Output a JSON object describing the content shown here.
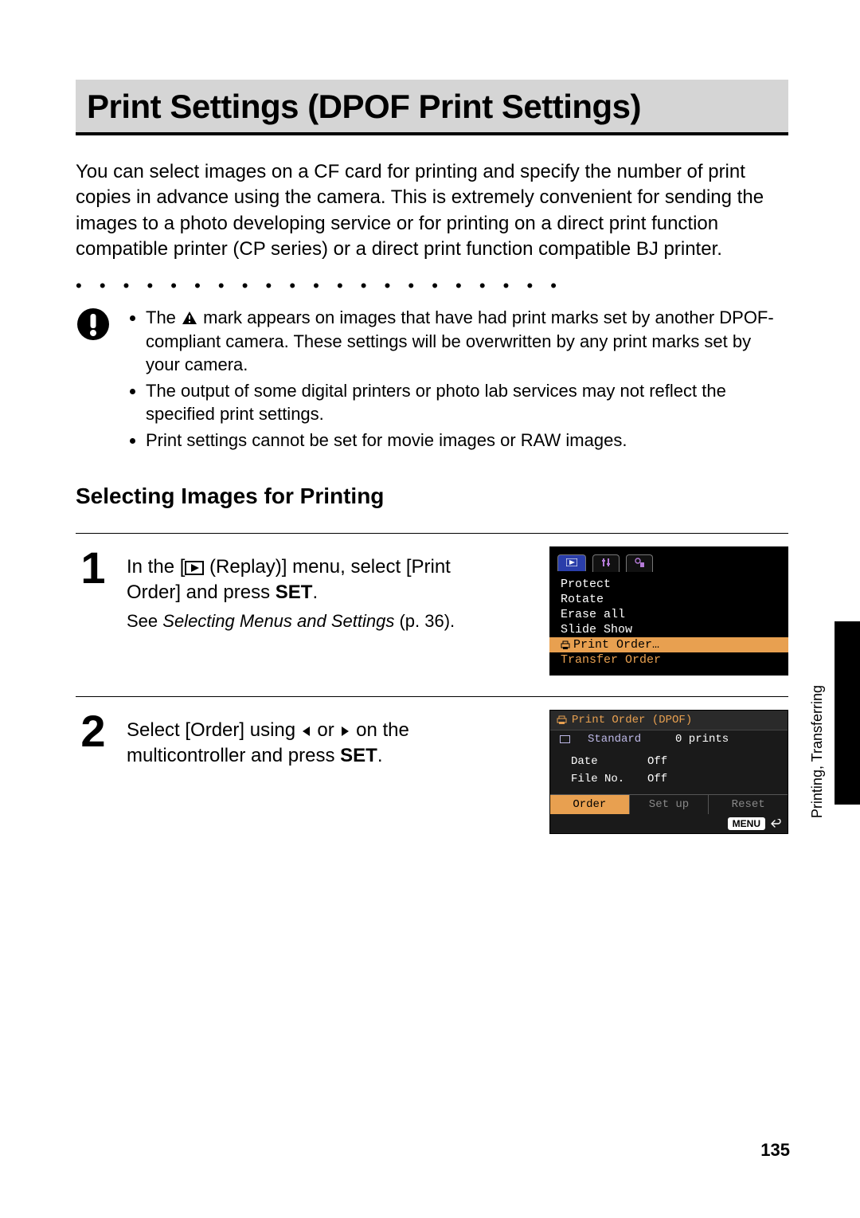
{
  "page_number": "135",
  "side_tab": "Printing, Transferring",
  "title": "Print Settings (DPOF Print Settings)",
  "intro": "You can select images on a CF card for printing and specify the number of print copies in advance using the camera. This is extremely convenient for sending the images to a photo developing service or for printing on a direct print function compatible printer (CP series) or a direct print function compatible BJ printer.",
  "warn": {
    "b1a": "The ",
    "b1b": " mark appears on images that have had print marks set by another DPOF-compliant camera. These settings will be overwritten by any print marks set by your camera.",
    "b2": "The output of some digital printers or photo lab services may not reflect the specified print settings.",
    "b3": "Print settings cannot be set for movie images or RAW images."
  },
  "subhead": "Selecting Images for Printing",
  "step1": {
    "num": "1",
    "line_a": "In the [",
    "line_b": " (Replay)] menu, select [Print Order] and press ",
    "line_c": "SET",
    "line_d": ".",
    "ref_a": "See ",
    "ref_b": "Selecting Menus and Settings",
    "ref_c": " (p. 36).",
    "lcd": {
      "items": [
        "Protect",
        "Rotate",
        "Erase all",
        "Slide Show",
        "Print Order…",
        "Transfer Order"
      ],
      "selected_index": 4
    }
  },
  "step2": {
    "num": "2",
    "line_a": "Select [Order] using ",
    "line_b": " or ",
    "line_c": " on the multicontroller and press ",
    "line_d": "SET",
    "line_e": ".",
    "lcd": {
      "title": "Print Order (DPOF)",
      "type_label": "Standard",
      "count": "0 prints",
      "date_label": "Date",
      "date_value": "Off",
      "fileno_label": "File No.",
      "fileno_value": "Off",
      "tabs": [
        "Order",
        "Set up",
        "Reset"
      ],
      "selected_tab": 0,
      "menu": "MENU"
    }
  }
}
